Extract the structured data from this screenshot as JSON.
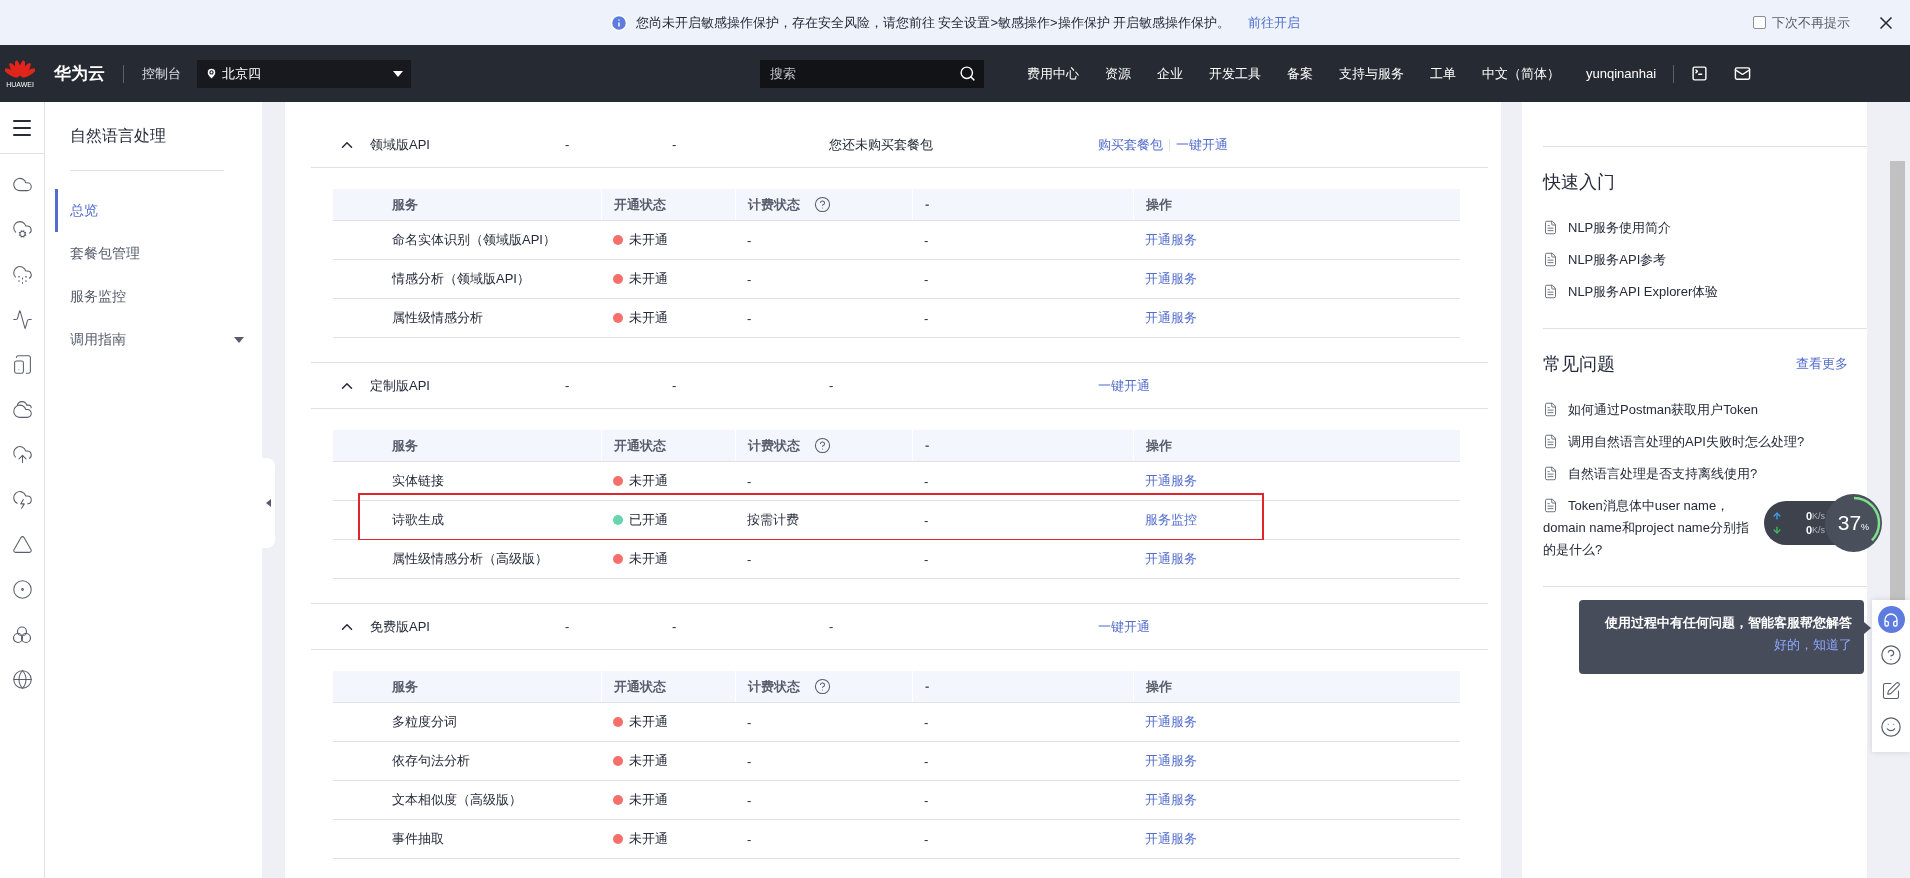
{
  "banner": {
    "text": "您尚未开启敏感操作保护，存在安全风险，请您前往 安全设置>敏感操作>操作保护 开启敏感操作保护。",
    "link": "前往开启",
    "checkbox": {
      "label": "下次不再提示",
      "checked": false
    }
  },
  "nav": {
    "logo_text": "HUAWEI",
    "brand": "华为云",
    "console": "控制台",
    "region": "北京四",
    "search": {
      "placeholder": "搜索"
    },
    "menu": [
      "费用中心",
      "资源",
      "企业",
      "开发工具",
      "备案",
      "支持与服务",
      "工单",
      "中文（简体）"
    ],
    "user": "yunqinanhai"
  },
  "sidebar": {
    "title": "自然语言处理",
    "items": [
      {
        "label": "总览",
        "selected": true,
        "kind": "link"
      },
      {
        "label": "套餐包管理",
        "selected": false,
        "kind": "link"
      },
      {
        "label": "服务监控",
        "selected": false,
        "kind": "link"
      },
      {
        "label": "调用指南",
        "selected": false,
        "kind": "group"
      }
    ]
  },
  "groups": [
    {
      "name": "领域版API",
      "expanded": true,
      "column_2": "-",
      "column_3": "-",
      "column_4": "您还未购买套餐包",
      "actions": [
        "购买套餐包",
        "一键开通"
      ],
      "table": {
        "columns": [
          "服务",
          "开通状态",
          "计费状态",
          "-",
          "操作"
        ],
        "rows": [
          {
            "service": "命名实体识别（领域版API）",
            "status": "未开通",
            "color": "#f66f6a",
            "billing": "-",
            "column_4": "-",
            "action": "开通服务",
            "highlighted": false
          },
          {
            "service": "情感分析（领域版API）",
            "status": "未开通",
            "color": "#f66f6a",
            "billing": "-",
            "column_4": "-",
            "action": "开通服务",
            "highlighted": false
          },
          {
            "service": "属性级情感分析",
            "status": "未开通",
            "color": "#f66f6a",
            "billing": "-",
            "column_4": "-",
            "action": "开通服务",
            "highlighted": false
          }
        ]
      }
    },
    {
      "name": "定制版API",
      "expanded": true,
      "column_2": "-",
      "column_3": "-",
      "column_4": "-",
      "actions": [
        "一键开通"
      ],
      "table": {
        "columns": [
          "服务",
          "开通状态",
          "计费状态",
          "-",
          "操作"
        ],
        "rows": [
          {
            "service": "实体链接",
            "status": "未开通",
            "color": "#f66f6a",
            "billing": "-",
            "column_4": "-",
            "action": "开通服务",
            "highlighted": false
          },
          {
            "service": "诗歌生成",
            "status": "已开通",
            "color": "#66d6ad",
            "billing": "按需计费",
            "column_4": "-",
            "action": "服务监控",
            "highlighted": true
          },
          {
            "service": "属性级情感分析（高级版）",
            "status": "未开通",
            "color": "#f66f6a",
            "billing": "-",
            "column_4": "-",
            "action": "开通服务",
            "highlighted": false
          }
        ]
      }
    },
    {
      "name": "免费版API",
      "expanded": true,
      "column_2": "-",
      "column_3": "-",
      "column_4": "-",
      "actions": [
        "一键开通"
      ],
      "table": {
        "columns": [
          "服务",
          "开通状态",
          "计费状态",
          "-",
          "操作"
        ],
        "rows": [
          {
            "service": "多粒度分词",
            "status": "未开通",
            "color": "#f66f6a",
            "billing": "-",
            "column_4": "-",
            "action": "开通服务",
            "highlighted": false
          },
          {
            "service": "依存句法分析",
            "status": "未开通",
            "color": "#f66f6a",
            "billing": "-",
            "column_4": "-",
            "action": "开通服务",
            "highlighted": false
          },
          {
            "service": "文本相似度（高级版）",
            "status": "未开通",
            "color": "#f66f6a",
            "billing": "-",
            "column_4": "-",
            "action": "开通服务",
            "highlighted": false
          },
          {
            "service": "事件抽取",
            "status": "未开通",
            "color": "#f66f6a",
            "billing": "-",
            "column_4": "-",
            "action": "开通服务",
            "highlighted": false
          }
        ]
      }
    }
  ],
  "quick_start": {
    "title": "快速入门",
    "items": [
      "NLP服务使用简介",
      "NLP服务API参考",
      "NLP服务API Explorer体验"
    ]
  },
  "faq": {
    "title": "常见问题",
    "more": "查看更多",
    "items": [
      "如何通过Postman获取用户Token",
      "调用自然语言处理的API失败时怎么处理?",
      "自然语言处理是否支持离线使用?",
      "Token消息体中user name，domain name和project name分别指的是什么?"
    ]
  },
  "speed_widget": {
    "upload": "0",
    "upload_unit": "K/s",
    "download": "0",
    "download_unit": "K/s",
    "percent": "37",
    "percent_sign": "%",
    "level": 0.37
  },
  "tooltip": {
    "text": "使用过程中有任何问题，智能客服帮您解答",
    "link": "好的，知道了"
  }
}
